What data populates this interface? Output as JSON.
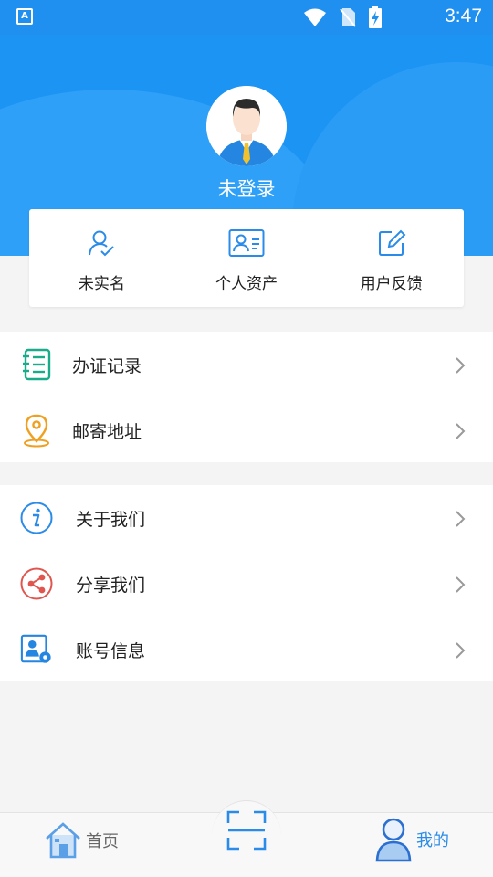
{
  "status_bar": {
    "app_badge": "A",
    "time": "3:47",
    "icons": [
      "wifi-icon",
      "no-sim-icon",
      "battery-charging-icon"
    ]
  },
  "colors": {
    "primary_blue": "#1c94f4",
    "status_blue": "#1f8ff0",
    "green_icon": "#1aab8a",
    "orange_icon": "#f0a020",
    "red_icon": "#e0564f",
    "tab_active": "#2b8be8"
  },
  "profile": {
    "login_status": "未登录",
    "avatar_icon": "user-avatar-icon"
  },
  "quick_actions": [
    {
      "label": "未实名",
      "icon": "verify-user-icon"
    },
    {
      "label": "个人资产",
      "icon": "id-card-icon"
    },
    {
      "label": "用户反馈",
      "icon": "feedback-edit-icon"
    }
  ],
  "menu_group_1": [
    {
      "label": "办证记录",
      "icon": "record-notebook-icon"
    },
    {
      "label": "邮寄地址",
      "icon": "location-pin-icon"
    }
  ],
  "menu_group_2": [
    {
      "label": "关于我们",
      "icon": "info-icon"
    },
    {
      "label": "分享我们",
      "icon": "share-icon"
    },
    {
      "label": "账号信息",
      "icon": "account-settings-icon"
    }
  ],
  "tab_bar": {
    "home_label": "首页",
    "mine_label": "我的",
    "scan_icon": "scan-icon"
  }
}
